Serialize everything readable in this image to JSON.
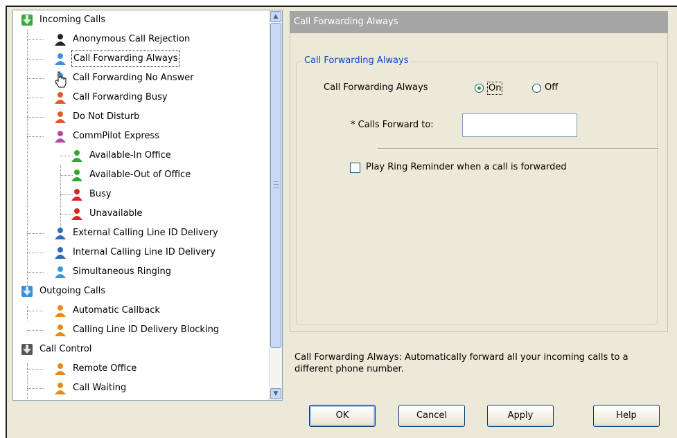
{
  "tree": {
    "items": [
      {
        "label": "Incoming Calls",
        "icon": "green-down-arrow-icon",
        "level": 0
      },
      {
        "label": "Anonymous Call Rejection",
        "icon": "anonymous-rejection-icon",
        "level": 1
      },
      {
        "label": "Call Forwarding Always",
        "icon": "forwarding-always-icon",
        "level": 1,
        "selected": true
      },
      {
        "label": "Call Forwarding No Answer",
        "icon": "forwarding-no-answer-icon",
        "level": 1
      },
      {
        "label": "Call Forwarding Busy",
        "icon": "forwarding-busy-icon",
        "level": 1
      },
      {
        "label": "Do Not Disturb",
        "icon": "do-not-disturb-icon",
        "level": 1
      },
      {
        "label": "CommPilot Express",
        "icon": "commpilot-express-icon",
        "level": 1
      },
      {
        "label": "Available-In Office",
        "icon": "available-in-office-icon",
        "level": 2
      },
      {
        "label": "Available-Out of Office",
        "icon": "available-out-of-office-icon",
        "level": 2
      },
      {
        "label": "Busy",
        "icon": "busy-icon",
        "level": 2
      },
      {
        "label": "Unavailable",
        "icon": "unavailable-icon",
        "level": 2
      },
      {
        "label": "External Calling Line ID Delivery",
        "icon": "external-id-icon",
        "level": 1
      },
      {
        "label": "Internal Calling Line ID Delivery",
        "icon": "internal-id-icon",
        "level": 1
      },
      {
        "label": "Simultaneous Ringing",
        "icon": "simultaneous-ringing-icon",
        "level": 1
      },
      {
        "label": "Outgoing Calls",
        "icon": "outgoing-house-icon",
        "level": 0
      },
      {
        "label": "Automatic Callback",
        "icon": "automatic-callback-icon",
        "level": 1
      },
      {
        "label": "Calling Line ID Delivery Blocking",
        "icon": "id-blocking-icon",
        "level": 1
      },
      {
        "label": "Call Control",
        "icon": "phone-icon",
        "level": 0
      },
      {
        "label": "Remote Office",
        "icon": "remote-office-icon",
        "level": 1
      },
      {
        "label": "Call Waiting",
        "icon": "call-waiting-icon",
        "level": 1
      }
    ]
  },
  "panel": {
    "header": "Call Forwarding Always",
    "group_title": "Call Forwarding Always",
    "toggle_label": "Call Forwarding Always",
    "on_label": "On",
    "off_label": "Off",
    "forward_label": "* Calls Forward to:",
    "forward_value": "",
    "reminder_label": "Play Ring Reminder when a call is forwarded",
    "description": "Call Forwarding Always: Automatically forward all your incoming calls to a different phone number."
  },
  "buttons": {
    "ok": "OK",
    "cancel": "Cancel",
    "apply": "Apply",
    "help": "Help"
  },
  "colors": {
    "header_bg": "#a5a5a5",
    "group_title": "#0046d5",
    "dialog_bg": "#ece9d8"
  }
}
